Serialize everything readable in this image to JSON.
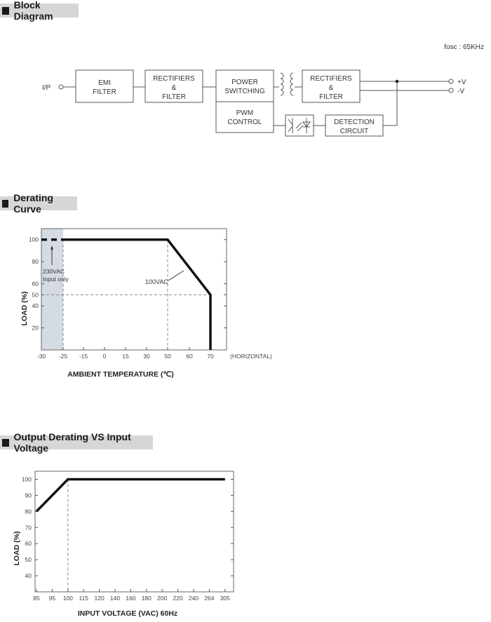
{
  "sections": {
    "block_diagram": {
      "title": "Block Diagram",
      "fosc": "fosc : 65KHz",
      "input_label": "I/P",
      "output_pos": "+V",
      "output_neg": "-V",
      "blocks": {
        "emi": [
          "EMI",
          "FILTER"
        ],
        "rect1": [
          "RECTIFIERS",
          "&",
          "FILTER"
        ],
        "power": [
          "POWER",
          "SWITCHING"
        ],
        "pwm": [
          "PWM",
          "CONTROL"
        ],
        "rect2": [
          "RECTIFIERS",
          "&",
          "FILTER"
        ],
        "detect": [
          "DETECTION",
          "CIRCUIT"
        ]
      },
      "icons": [
        "transformer-icon",
        "optocoupler-icon"
      ]
    },
    "derating_curve": {
      "title": "Derating Curve"
    },
    "output_derating": {
      "title": "Output Derating VS Input Voltage"
    }
  },
  "chart_data": [
    {
      "type": "line",
      "title": "Derating Curve",
      "xlabel": "AMBIENT TEMPERATURE (℃)",
      "ylabel": "LOAD (%)",
      "x_tick_labels": [
        "-30",
        "-25",
        "-15",
        "0",
        "15",
        "30",
        "50",
        "60",
        "70"
      ],
      "x_suffix_label": "(HORIZONTAL)",
      "y_tick_labels": [
        "20",
        "40",
        "50",
        "60",
        "80",
        "100"
      ],
      "y_ticks": [
        20,
        40,
        50,
        60,
        80,
        100
      ],
      "ylim": [
        0,
        110
      ],
      "grid": false,
      "series": [
        {
          "name": "100VAC",
          "points": [
            [
              -25,
              100
            ],
            [
              50,
              100
            ],
            [
              70,
              50
            ],
            [
              70,
              0
            ]
          ],
          "dashed_extension": {
            "label": "230VAC Input only",
            "points": [
              [
                -30,
                100
              ],
              [
                -25,
                100
              ]
            ]
          }
        }
      ],
      "shaded_region": {
        "x_from": -30,
        "x_to": -25,
        "label": "230VAC Input only"
      },
      "reference_lines": [
        {
          "orientation": "vertical",
          "x": -25
        },
        {
          "orientation": "vertical",
          "x": 50
        },
        {
          "orientation": "horizontal",
          "y": 50
        }
      ],
      "annotations": [
        {
          "text": "230VAC",
          "line2": "Input only"
        },
        {
          "text": "100VAC"
        }
      ]
    },
    {
      "type": "line",
      "title": "Output Derating VS Input Voltage",
      "xlabel": "INPUT VOLTAGE (VAC) 60Hz",
      "ylabel": "LOAD (%)",
      "x_tick_labels": [
        "85",
        "95",
        "100",
        "115",
        "120",
        "140",
        "160",
        "180",
        "200",
        "220",
        "240",
        "264",
        "305"
      ],
      "y_tick_labels": [
        "40",
        "50",
        "60",
        "70",
        "80",
        "90",
        "100"
      ],
      "y_ticks": [
        40,
        50,
        60,
        70,
        80,
        90,
        100
      ],
      "ylim": [
        30,
        105
      ],
      "grid": false,
      "series": [
        {
          "name": "Load",
          "points": [
            [
              85,
              80
            ],
            [
              100,
              100
            ],
            [
              305,
              100
            ]
          ]
        }
      ],
      "reference_lines": [
        {
          "orientation": "vertical",
          "x": 100
        }
      ]
    }
  ]
}
